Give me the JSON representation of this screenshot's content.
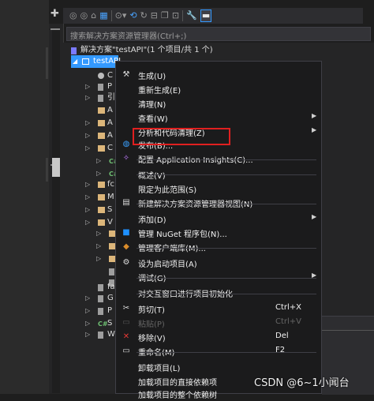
{
  "search": {
    "placeholder": "搜索解决方案资源管理器(Ctrl+;)"
  },
  "solution": {
    "title": "解决方案\"testAPI\"(1 个项目/共 1 个)"
  },
  "project": {
    "name": "testAPI"
  },
  "tree_rows": [
    {
      "label": "C",
      "icon": "gear"
    },
    {
      "label": "P",
      "icon": "wrench"
    },
    {
      "label": "引",
      "icon": "refs"
    },
    {
      "label": "A",
      "icon": "folder"
    },
    {
      "label": "A",
      "icon": "folder"
    },
    {
      "label": "A",
      "icon": "folder"
    },
    {
      "label": "C",
      "icon": "folder"
    },
    {
      "label": "c#",
      "icon": "cs"
    },
    {
      "label": "c#",
      "icon": "cs"
    },
    {
      "label": "fc",
      "icon": "folder"
    },
    {
      "label": "M",
      "icon": "folder"
    },
    {
      "label": "S",
      "icon": "folder"
    },
    {
      "label": "V",
      "icon": "folder"
    },
    {
      "label": "",
      "icon": "folder"
    },
    {
      "label": "",
      "icon": "folder"
    },
    {
      "label": "",
      "icon": "folder"
    },
    {
      "label": "",
      "icon": "file"
    },
    {
      "label": "",
      "icon": "file"
    },
    {
      "label": "fa",
      "icon": "file"
    },
    {
      "label": "G",
      "icon": "file"
    },
    {
      "label": "P",
      "icon": "file"
    },
    {
      "label": "S",
      "icon": "cs"
    },
    {
      "label": "W",
      "icon": "file"
    }
  ],
  "menu": {
    "items": [
      {
        "label": "生成(U)",
        "shortcut": "",
        "icon": "build-icon"
      },
      {
        "label": "重新生成(E)",
        "shortcut": "",
        "icon": ""
      },
      {
        "label": "清理(N)",
        "shortcut": "",
        "icon": ""
      },
      {
        "label": "查看(W)",
        "shortcut": "",
        "icon": "",
        "submenu": true
      },
      {
        "label": "分析和代码清理(Z)",
        "shortcut": "",
        "icon": "",
        "submenu": true
      },
      {
        "label": "发布(B)...",
        "shortcut": "",
        "icon": "publish-icon"
      },
      {
        "label": "配置 Application Insights(C)...",
        "shortcut": "",
        "icon": "insights-icon"
      },
      {
        "label": "概述(V)",
        "shortcut": "",
        "icon": ""
      },
      {
        "label": "限定为此范围(S)",
        "shortcut": "",
        "icon": ""
      },
      {
        "label": "新建解决方案资源管理器视图(N)",
        "shortcut": "",
        "icon": "new-view-icon"
      },
      {
        "label": "添加(D)",
        "shortcut": "",
        "icon": "",
        "submenu": true
      },
      {
        "label": "管理 NuGet 程序包(N)...",
        "shortcut": "",
        "icon": "nuget-icon"
      },
      {
        "label": "管理客户端库(M)...",
        "shortcut": "",
        "icon": "library-icon"
      },
      {
        "label": "设为启动项目(A)",
        "shortcut": "",
        "icon": "startup-gear-icon"
      },
      {
        "label": "调试(G)",
        "shortcut": "",
        "icon": "",
        "submenu": true
      },
      {
        "label": "对交互窗口进行项目初始化",
        "shortcut": "",
        "icon": ""
      },
      {
        "label": "剪切(T)",
        "shortcut": "Ctrl+X",
        "icon": "cut-icon"
      },
      {
        "label": "粘贴(P)",
        "shortcut": "Ctrl+V",
        "icon": "paste-icon",
        "disabled": true
      },
      {
        "label": "移除(V)",
        "shortcut": "Del",
        "icon": "remove-icon"
      },
      {
        "label": "重命名(M)",
        "shortcut": "F2",
        "icon": "rename-icon"
      },
      {
        "label": "卸载项目(L)",
        "shortcut": "",
        "icon": ""
      },
      {
        "label": "加载项目的直接依赖项",
        "shortcut": "",
        "icon": ""
      },
      {
        "label": "加载项目的整个依赖树",
        "shortcut": "",
        "icon": ""
      }
    ]
  },
  "watermark": "CSDN @6~1小闻台",
  "colors": {
    "selection": "#3399ff",
    "highlight_box": "#e02020",
    "menu_bg": "#1b1b1c"
  }
}
